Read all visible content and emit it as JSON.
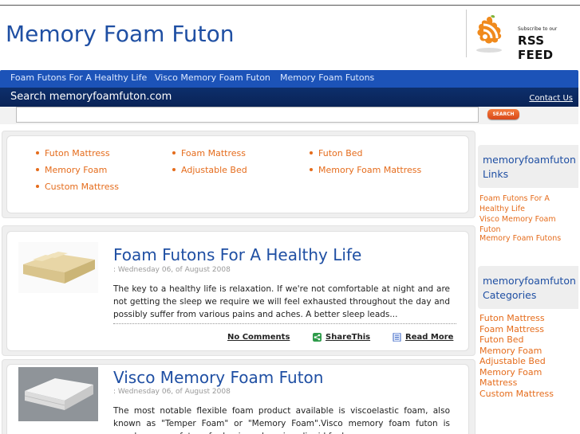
{
  "site": {
    "title": "Memory Foam Futon"
  },
  "rss": {
    "subscribe": "Subscribe to our",
    "feed": "RSS FEED"
  },
  "nav": {
    "items": [
      "Foam Futons For A Healthy Life",
      "Visco Memory Foam Futon",
      "Memory Foam Futons"
    ]
  },
  "search": {
    "title": "Search memoryfoamfuton.com",
    "contact": "Contact Us",
    "button": "SEARCH",
    "value": ""
  },
  "categories": {
    "items": [
      "Futon Mattress",
      "Foam Mattress",
      "Futon Bed",
      "Memory Foam",
      "Adjustable Bed",
      "Memory Foam Mattress",
      "Custom Mattress"
    ]
  },
  "posts": [
    {
      "title": "Foam Futons For A Healthy Life",
      "date": ": Wednesday 06, of August 2008",
      "excerpt": "The key to a healthy life is relaxation. If we're not comfortable at night and are not getting the sleep we require we will feel exhausted throughout the day and possibly suffer from various pains and aches. A better sleep leads...",
      "comments": "No Comments",
      "share": "ShareThis",
      "more": "Read More"
    },
    {
      "title": "Visco Memory Foam Futon",
      "date": ": Wednesday 06, of August 2008",
      "excerpt": "The most notable flexible foam product available is viscoelastic foam, also known as \"Temper Foam\" or \"Memory Foam\".Visco memory foam futon is popular among futons for having a luxurious liquid feel..."
    }
  ],
  "sidebar": {
    "links_heading": "memoryfoamfuton Links",
    "links": [
      "Foam Futons For A Healthy Life",
      "Visco Memory Foam Futon",
      "Memory Foam Futons"
    ],
    "categories_heading": "memoryfoamfuton Categories",
    "categories": [
      "Futon Mattress",
      "Foam Mattress",
      "Futon Bed",
      "Memory Foam",
      "Adjustable Bed",
      "Memory Foam Mattress",
      "Custom Mattress"
    ]
  },
  "colors": {
    "title_blue": "#1f4fa3",
    "nav_blue": "#1c53b8",
    "search_navy": "#0d2f6c",
    "link_orange": "#e56c1c"
  }
}
